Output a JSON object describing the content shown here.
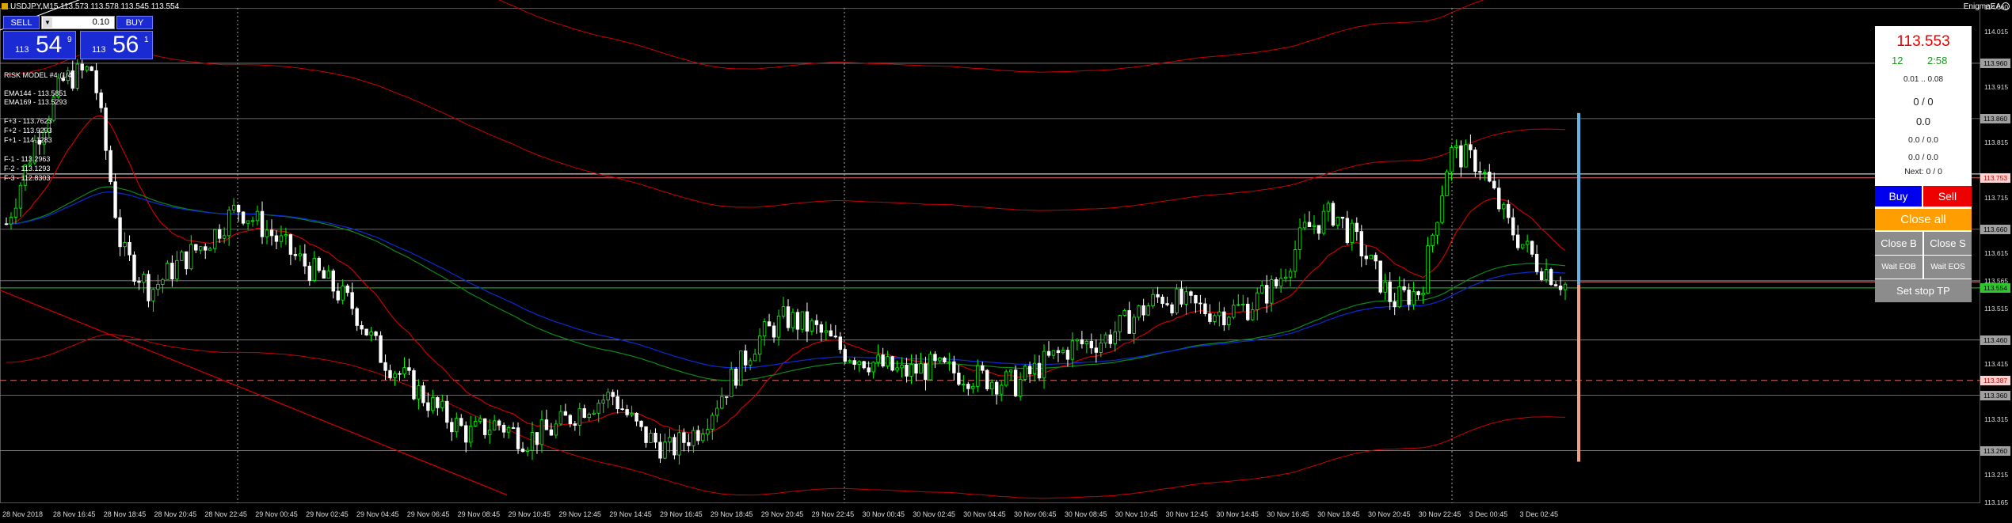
{
  "window": {
    "title": "USDJPY,M15  113.573 113.578 113.545 113.554",
    "ea_name": "EnigmaEA"
  },
  "one_click": {
    "sell_label": "SELL",
    "buy_label": "BUY",
    "lot_value": "0.10",
    "bid": {
      "small": "113",
      "large": "54",
      "sup": "9"
    },
    "ask": {
      "small": "113",
      "large": "56",
      "sup": "1"
    }
  },
  "indicators": {
    "risk_model": "RISK MODEL #4 (1/4)",
    "ema144": "EMA144 - 113.5851",
    "ema169": "EMA169 - 113.5293",
    "fib_plus3": "F+3 - 113.7623",
    "fib_plus2": "F+2 - 113.9293",
    "fib_plus1": "F+1 - 114.1283",
    "fib_minus1": "F-1 - 113.2963",
    "fib_minus2": "F-2 - 113.1293",
    "fib_minus3": "F-3 - 112.8303"
  },
  "price_axis": [
    {
      "label": "114.060",
      "kind": "plain"
    },
    {
      "label": "114.015",
      "kind": "plain"
    },
    {
      "label": "113.960",
      "kind": "gray"
    },
    {
      "label": "113.915",
      "kind": "plain"
    },
    {
      "label": "113.860",
      "kind": "gray"
    },
    {
      "label": "113.815",
      "kind": "plain"
    },
    {
      "label": "113.753",
      "kind": "pink"
    },
    {
      "label": "113.715",
      "kind": "plain"
    },
    {
      "label": "113.660",
      "kind": "gray"
    },
    {
      "label": "113.615",
      "kind": "plain"
    },
    {
      "label": "113.565",
      "kind": "plain"
    },
    {
      "label": "113.554",
      "kind": "green"
    },
    {
      "label": "113.515",
      "kind": "plain"
    },
    {
      "label": "113.460",
      "kind": "gray"
    },
    {
      "label": "113.415",
      "kind": "plain"
    },
    {
      "label": "113.387",
      "kind": "pink"
    },
    {
      "label": "113.360",
      "kind": "gray"
    },
    {
      "label": "113.315",
      "kind": "plain"
    },
    {
      "label": "113.260",
      "kind": "gray"
    },
    {
      "label": "113.215",
      "kind": "plain"
    },
    {
      "label": "113.165",
      "kind": "plain"
    }
  ],
  "time_axis": [
    "28 Nov 2018",
    "28 Nov 16:45",
    "28 Nov 18:45",
    "28 Nov 20:45",
    "28 Nov 22:45",
    "29 Nov 00:45",
    "29 Nov 02:45",
    "29 Nov 04:45",
    "29 Nov 06:45",
    "29 Nov 08:45",
    "29 Nov 10:45",
    "29 Nov 12:45",
    "29 Nov 14:45",
    "29 Nov 16:45",
    "29 Nov 18:45",
    "29 Nov 20:45",
    "29 Nov 22:45",
    "30 Nov 00:45",
    "30 Nov 02:45",
    "30 Nov 04:45",
    "30 Nov 06:45",
    "30 Nov 08:45",
    "30 Nov 10:45",
    "30 Nov 12:45",
    "30 Nov 14:45",
    "30 Nov 16:45",
    "30 Nov 18:45",
    "30 Nov 20:45",
    "30 Nov 22:45",
    "3 Dec 00:45",
    "3 Dec 02:45"
  ],
  "trade_panel": {
    "price": "113.553",
    "points": "12",
    "timer": "2:58",
    "lot_range": "0.01 .. 0.08",
    "count": "0 / 0",
    "profit": "0.0",
    "buy_sell_profit": "0.0 / 0.0",
    "lots": "0.0 / 0.0",
    "next": "Next: 0 / 0",
    "buy_label": "Buy",
    "sell_label": "Sell",
    "close_all_label": "Close all",
    "close_b_label": "Close B",
    "close_s_label": "Close S",
    "wait_eob_label": "Wait EOB",
    "wait_eos_label": "Wait EOS",
    "set_stop_tp_label": "Set stop TP"
  },
  "colors": {
    "background": "#000000",
    "candle_up": "#00ff00",
    "candle_down": "#ffffff",
    "ema_blue": "#0a2bd8",
    "ema_green": "#0c8a1a",
    "envelope_red": "#cc0000",
    "grid": "#ffffff"
  },
  "chart_data": {
    "type": "candlestick",
    "symbol": "USDJPY",
    "timeframe": "M15",
    "ylim": [
      113.165,
      114.06
    ],
    "close_path": [
      113.67,
      113.82,
      113.93,
      113.95,
      113.62,
      113.55,
      113.6,
      113.64,
      113.7,
      113.66,
      113.61,
      113.57,
      113.52,
      113.43,
      113.38,
      113.33,
      113.29,
      113.31,
      113.28,
      113.3,
      113.34,
      113.36,
      113.29,
      113.26,
      113.3,
      113.38,
      113.46,
      113.5,
      113.48,
      113.44,
      113.42,
      113.4,
      113.41,
      113.4,
      113.39,
      113.38,
      113.42,
      113.45,
      113.46,
      113.5,
      113.54,
      113.52,
      113.51,
      113.52,
      113.56,
      113.66,
      113.69,
      113.62,
      113.53,
      113.55,
      113.8,
      113.78,
      113.67,
      113.6,
      113.56
    ]
  }
}
